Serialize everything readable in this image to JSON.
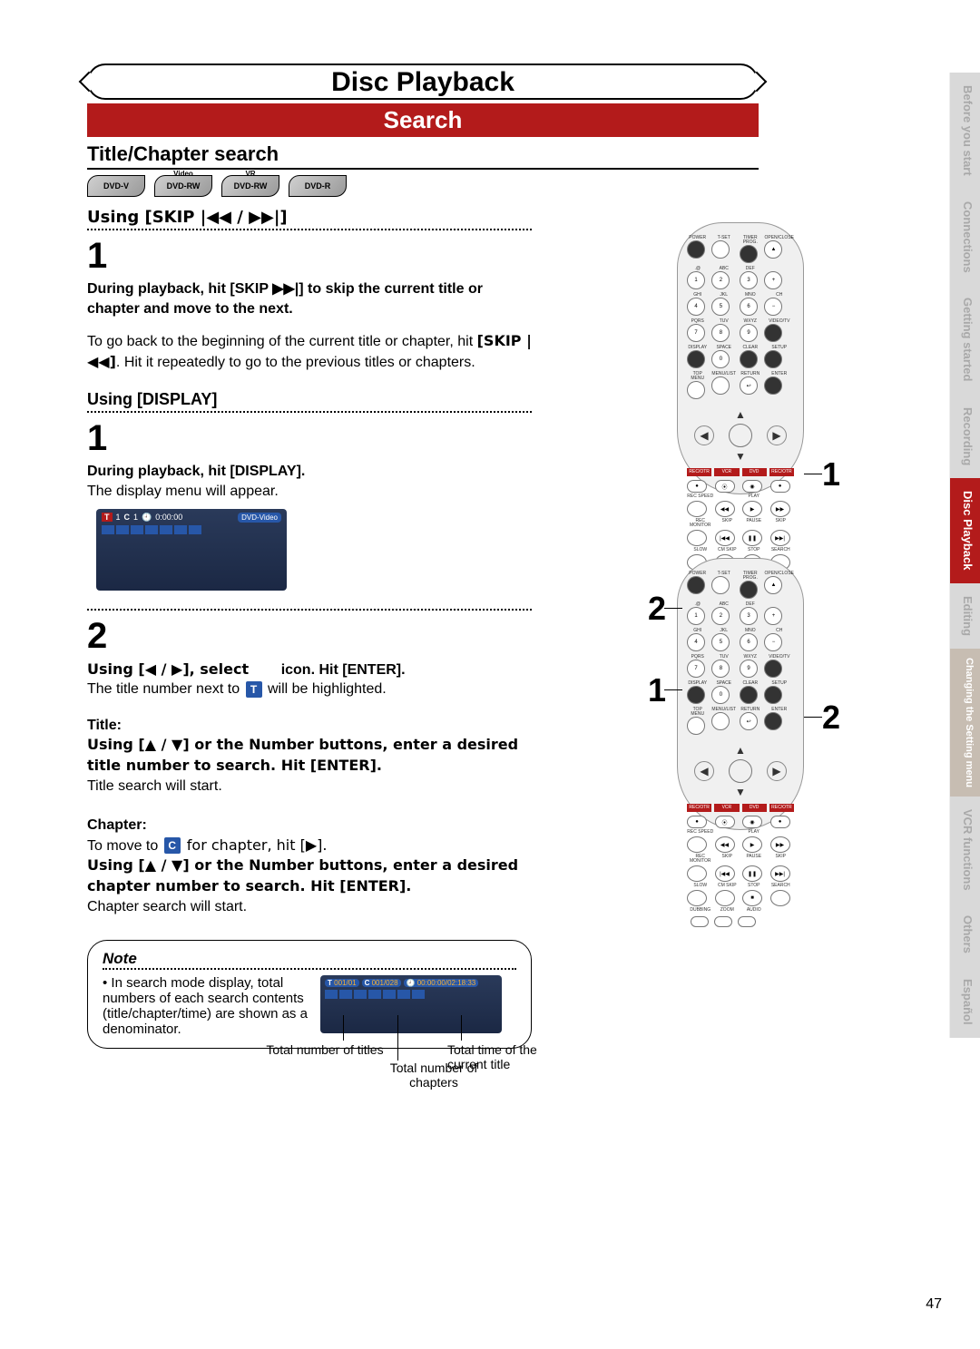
{
  "header": {
    "title": "Disc Playback"
  },
  "search_bar": "Search",
  "section_title": "Title/Chapter search",
  "badges": [
    {
      "main": "DVD-V",
      "sup": ""
    },
    {
      "main": "DVD-RW",
      "sup": "Video"
    },
    {
      "main": "DVD-RW",
      "sup": "VR"
    },
    {
      "main": "DVD-R",
      "sup": ""
    }
  ],
  "skip": {
    "heading": "Using [SKIP |◀◀ / ▶▶|]",
    "num": "1",
    "bold1": "During playback, hit [SKIP ▶▶|] to skip the current title or chapter and move to the next.",
    "plain1a": "To go back to the beginning of the current title or chapter, hit ",
    "plain1_skip": "[SKIP |◀◀]",
    "plain1b": ". Hit it repeatedly to go to the previous titles or chapters."
  },
  "display": {
    "heading": "Using [DISPLAY]",
    "num1": "1",
    "bold1": "During playback, hit [DISPLAY].",
    "plain1": "The display menu will appear.",
    "osd": {
      "t": "T",
      "t_val": "1",
      "c": "C",
      "c_val": "1",
      "clock": "0:00:00",
      "tag": "DVD-Video"
    },
    "num2": "2",
    "line2a": "Using [◀ / ▶], select",
    "line2b": "icon. Hit [ENTER].",
    "plain2a": "The title number next to ",
    "plain2b": " will be highlighted.",
    "t_chip": "T",
    "title_label": "Title:",
    "title_bold": "Using [▲ / ▼] or the Number buttons, enter a desired title number to search. Hit [ENTER].",
    "title_plain": "Title search will start.",
    "chapter_label": "Chapter:",
    "chapter_plain1a": "To move to ",
    "chapter_plain1b": " for chapter, hit [▶].",
    "c_chip": "C",
    "chapter_bold": "Using [▲ / ▼] or the Number buttons, enter a desired chapter number to search. Hit [ENTER].",
    "chapter_plain2": "Chapter search will start."
  },
  "note": {
    "title": "Note",
    "bullet": "In search mode display, total numbers of each search contents (title/chapter/time) are shown as a denominator.",
    "osd": {
      "t": "T",
      "t_vals": "001/01",
      "c": "C",
      "c_vals": "001/028",
      "time": "00:00:00/02:18:33"
    },
    "labels": {
      "total_titles": "Total number of titles",
      "total_chapters": "Total number of chapters",
      "total_time": "Total time of the current title"
    }
  },
  "callouts": {
    "one": "1",
    "two": "2"
  },
  "side_tabs": [
    "Before you start",
    "Connections",
    "Getting started",
    "Recording",
    "Disc Playback",
    "Editing",
    "Changing the Setting menu",
    "VCR functions",
    "Others",
    "Español"
  ],
  "active_tab_index": 4,
  "page_number": "47",
  "remote_labels": {
    "power": "POWER",
    "tset": "T-SET",
    "timer": "TIMER PROG.",
    "open": "OPEN/CLOSE",
    "abc": "ABC",
    "def": "DEF",
    "ghi": "GHI",
    "jkl": "JKL",
    "mno": "MNO",
    "ch": "CH",
    "pqrs": "PQRS",
    "tuv": "TUV",
    "wxyz": "WXYZ",
    "video": "VIDEO/TV",
    "disp": "DISPLAY",
    "space": "SPACE",
    "clear": "CLEAR",
    "setup": "SETUP",
    "topmenu": "TOP MENU",
    "menulist": "MENU/LIST",
    "return": "RETURN",
    "enter": "ENTER",
    "recotr": "REC/OTR",
    "vcr": "VCR",
    "dvd": "DVD",
    "recspeed": "REC SPEED",
    "play": "PLAY",
    "recmon": "REC MONITOR",
    "skip": "SKIP",
    "pause": "PAUSE",
    "slow": "SLOW",
    "cmskip": "CM SKIP",
    "stop": "STOP",
    "search": "SEARCH",
    "dubbing": "DUBBING",
    "zoom": "ZOOM",
    "audio": "AUDIO"
  }
}
